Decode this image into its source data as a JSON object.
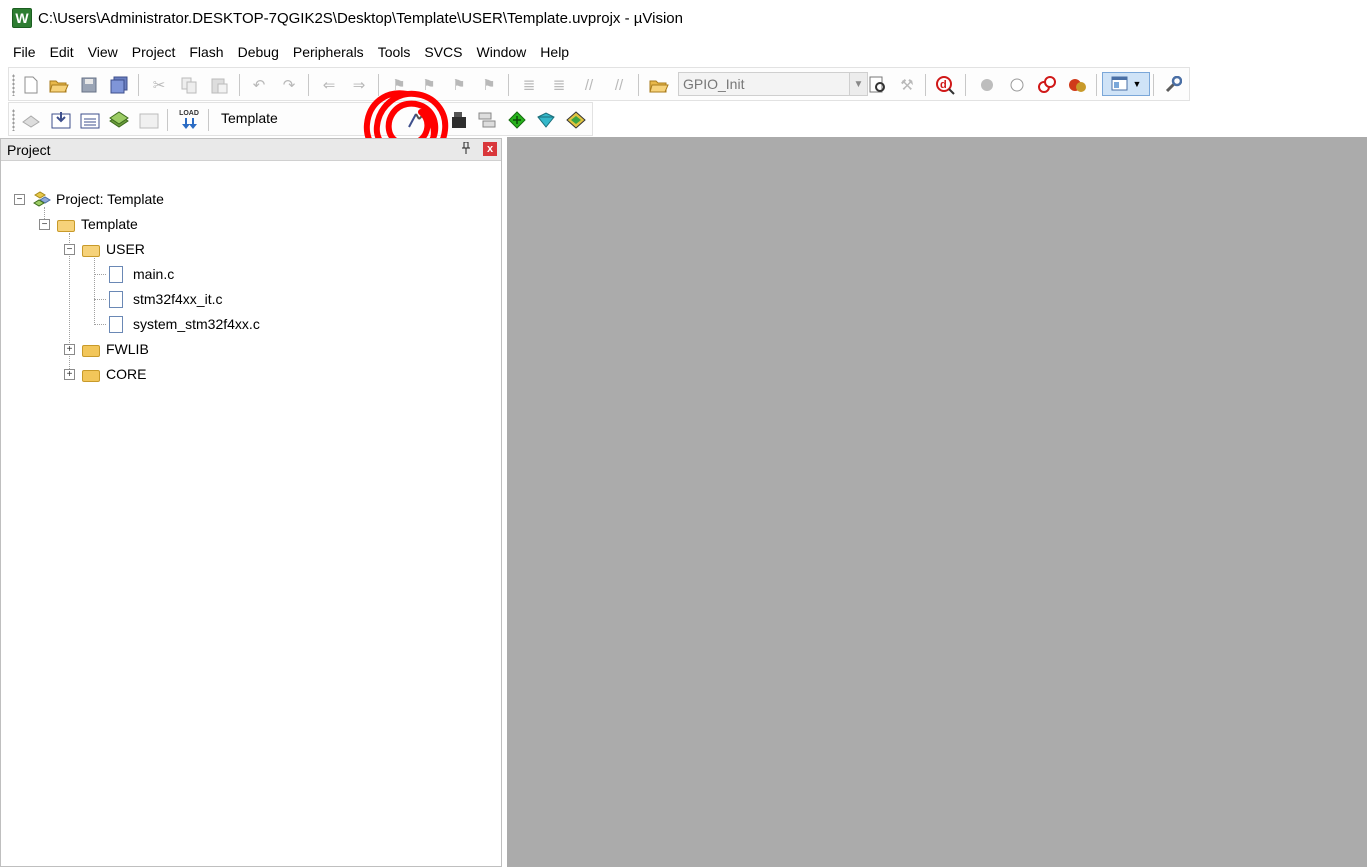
{
  "window": {
    "app_icon_letter": "W",
    "title": "C:\\Users\\Administrator.DESKTOP-7QGIK2S\\Desktop\\Template\\USER\\Template.uvprojx - µVision"
  },
  "menu": [
    "File",
    "Edit",
    "View",
    "Project",
    "Flash",
    "Debug",
    "Peripherals",
    "Tools",
    "SVCS",
    "Window",
    "Help"
  ],
  "toolbar": {
    "function_combo_value": "GPIO_Init",
    "target_name": "Template",
    "load_label": "LOAD"
  },
  "project_panel": {
    "title": "Project",
    "pin_glyph": "ᵖ",
    "close_glyph": "x",
    "tree": {
      "root": "Project: Template",
      "target": "Template",
      "groups": [
        {
          "name": "USER",
          "expanded": true,
          "files": [
            "main.c",
            "stm32f4xx_it.c",
            "system_stm32f4xx.c"
          ]
        },
        {
          "name": "FWLIB",
          "expanded": false,
          "files": []
        },
        {
          "name": "CORE",
          "expanded": false,
          "files": []
        }
      ]
    }
  },
  "colors": {
    "editor_background": "#ababab",
    "annotation": "#ff0000",
    "close_button": "#d9373b"
  }
}
